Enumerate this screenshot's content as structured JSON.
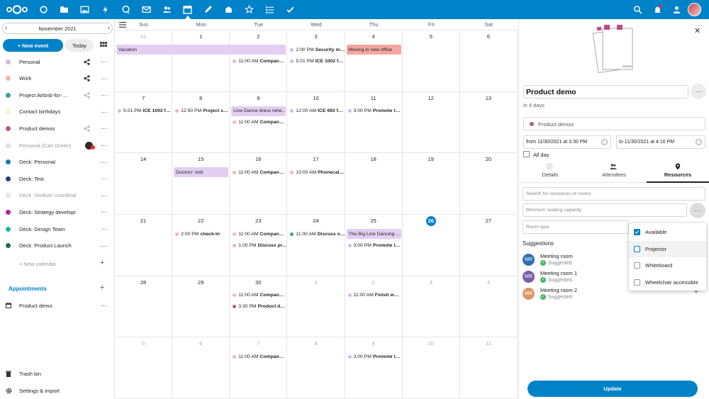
{
  "topbar": {
    "apps": [
      "dashboard-icon",
      "files-icon",
      "photos-icon",
      "activity-icon",
      "talk-icon",
      "mail-icon",
      "contacts-icon",
      "calendar-icon",
      "notes-icon",
      "deck-icon",
      "rating-icon",
      "tasks-icon",
      "check-icon"
    ],
    "right": [
      "search-icon",
      "notifications-icon",
      "contacts-menu-icon",
      "avatar"
    ]
  },
  "sidebar": {
    "month": "November 2021",
    "new_event": "+ New event",
    "today": "Today",
    "calendars": [
      {
        "label": "Personal",
        "color": "#d8b7e8",
        "share": true,
        "muted": false
      },
      {
        "label": "Work",
        "color": "#f3b6b1",
        "share": true,
        "muted": false
      },
      {
        "label": "Project Airbnb-for-…",
        "color": "#3e9e9e",
        "share": true,
        "muted": false
      },
      {
        "label": "Contact birthdays",
        "color": "#fbf3c8",
        "share": false,
        "muted": false
      },
      {
        "label": "Product demos",
        "color": "#b05a8e",
        "share": true,
        "muted": false
      },
      {
        "label": "Personal (Carl Green)",
        "color": "#f0dbe8",
        "share": false,
        "muted": true
      },
      {
        "label": "Deck: Personal",
        "color": "#0f7fa8",
        "share": false,
        "muted": false
      },
      {
        "label": "Deck: Test",
        "color": "#2a3a6e",
        "share": false,
        "muted": false
      },
      {
        "label": "Deck: Verilium coordination",
        "color": "#e4ecec",
        "share": false,
        "muted": true
      },
      {
        "label": "Deck: Strategy development",
        "color": "#b41fa3",
        "share": false,
        "muted": false
      },
      {
        "label": "Deck: Design Team",
        "color": "#1cb5a9",
        "share": false,
        "muted": false
      },
      {
        "label": "Deck: Product Launch",
        "color": "#1e6b55",
        "share": false,
        "muted": false
      }
    ],
    "new_calendar": "+ New calendar",
    "appointments_title": "Appointments",
    "appointment_item": "Product demo",
    "trash": "Trash bin",
    "settings": "Settings & import"
  },
  "calendar": {
    "days": [
      "Sun",
      "Mon",
      "Tue",
      "Wed",
      "Thu",
      "Fri",
      "Sat"
    ],
    "weeks": [
      [
        "31",
        "1",
        "2",
        "3",
        "4",
        "5",
        "6"
      ],
      [
        "7",
        "8",
        "9",
        "10",
        "11",
        "12",
        "13"
      ],
      [
        "14",
        "15",
        "16",
        "17",
        "18",
        "19",
        "20"
      ],
      [
        "21",
        "22",
        "23",
        "24",
        "25",
        "26",
        "27"
      ],
      [
        "28",
        "29",
        "30",
        "1",
        "2",
        "3",
        "4"
      ],
      [
        "5",
        "6",
        "7",
        "8",
        "9",
        "10",
        "11"
      ]
    ],
    "bars": [
      {
        "text": "Vacation",
        "week": 0,
        "startCol": 0,
        "span": 3,
        "color": "#e3cff2"
      },
      {
        "text": "Moving in new office",
        "week": 0,
        "startCol": 4,
        "span": 1,
        "color": "#f4a7a1"
      },
      {
        "text": "Line Dance dress rehe…",
        "week": 1,
        "startCol": 2,
        "span": 1,
        "color": "#e3cff2"
      },
      {
        "text": "Doctors' visit",
        "week": 2,
        "startCol": 1,
        "span": 1,
        "color": "#e3cff2"
      },
      {
        "text": "The Big Line Dancing …",
        "week": 3,
        "startCol": 4,
        "span": 1,
        "color": "#e3cff2"
      }
    ],
    "events": [
      {
        "week": 0,
        "col": 2,
        "row": 1,
        "time": "11:00 AM",
        "title": "Compan…",
        "color": "#f3b6b1"
      },
      {
        "week": 0,
        "col": 3,
        "row": 0,
        "time": "2:00 PM",
        "title": "Security m…",
        "color": "#d8b7e8"
      },
      {
        "week": 0,
        "col": 3,
        "row": 1,
        "time": "5:01 PM",
        "title": "ICE 1002 f…",
        "color": "#d8b7e8"
      },
      {
        "week": 1,
        "col": 0,
        "row": 0,
        "time": "5:01 PM",
        "title": "ICE 1002 f…",
        "color": "#d8b7e8"
      },
      {
        "week": 1,
        "col": 1,
        "row": 0,
        "time": "12:50 PM",
        "title": "Project s…",
        "color": "#f3b6b1"
      },
      {
        "week": 1,
        "col": 2,
        "row": 1,
        "time": "11:00 AM",
        "title": "Compan…",
        "color": "#f3b6b1"
      },
      {
        "week": 1,
        "col": 3,
        "row": 0,
        "time": "12:00 AM",
        "title": "ICE 693 f…",
        "color": "#d8b7e8"
      },
      {
        "week": 1,
        "col": 4,
        "row": 0,
        "time": "3:00 PM",
        "title": "Promote t…",
        "color": "#d8b7e8"
      },
      {
        "week": 2,
        "col": 2,
        "row": 0,
        "time": "11:00 AM",
        "title": "Compan…",
        "color": "#f3b6b1"
      },
      {
        "week": 2,
        "col": 3,
        "row": 0,
        "time": "10:00 AM",
        "title": "Phonecal…",
        "color": "#f3b6b1"
      },
      {
        "week": 3,
        "col": 1,
        "row": 0,
        "time": "2:00 PM",
        "title": "check-in",
        "color": "#f3b6b1"
      },
      {
        "week": 3,
        "col": 2,
        "row": 0,
        "time": "11:00 AM",
        "title": "Compan…",
        "color": "#f3b6b1"
      },
      {
        "week": 3,
        "col": 2,
        "row": 1,
        "time": "1:00 PM",
        "title": "Discuss pr…",
        "color": "#f3b6b1"
      },
      {
        "week": 3,
        "col": 3,
        "row": 0,
        "time": "11:00 AM",
        "title": "Discuss o…",
        "color": "#3e9e9e"
      },
      {
        "week": 3,
        "col": 4,
        "row": 1,
        "time": "3:00 PM",
        "title": "Promote t…",
        "color": "#d8b7e8"
      },
      {
        "week": 4,
        "col": 2,
        "row": 0,
        "time": "11:00 AM",
        "title": "Compan…",
        "color": "#f3b6b1"
      },
      {
        "week": 4,
        "col": 2,
        "row": 1,
        "time": "3:30 PM",
        "title": "Product d…",
        "color": "#b05a8e"
      },
      {
        "week": 4,
        "col": 4,
        "row": 0,
        "time": "11:00 AM",
        "title": "Finish w…",
        "color": "#d8b7e8"
      },
      {
        "week": 5,
        "col": 2,
        "row": 0,
        "time": "11:00 AM",
        "title": "Compan…",
        "color": "#f3b6b1"
      },
      {
        "week": 5,
        "col": 4,
        "row": 0,
        "time": "3:00 PM",
        "title": "Promote t…",
        "color": "#d8b7e8"
      }
    ]
  },
  "panel": {
    "title": "Product demo",
    "subtitle": "in 4 days",
    "calendar": "Product demos",
    "calendar_color": "#b05a8e",
    "from": "from 11/30/2021 at 3:30 PM",
    "to": "to 11/30/2021 at 4:10 PM",
    "all_day": "All day",
    "tabs": [
      "Details",
      "Attendees",
      "Resources"
    ],
    "search_placeholder": "Search for resources or rooms",
    "seating_placeholder": "Minimum seating capacity",
    "room_type_placeholder": "Room type",
    "suggestions_title": "Suggestions",
    "suggestions": [
      {
        "initials": "MR",
        "name": "Meeting room",
        "status": "Suggested.",
        "color": "#2f6fb5"
      },
      {
        "initials": "MR",
        "name": "Meeting room 1",
        "status": "Suggested.",
        "color": "#7b5ea7"
      },
      {
        "initials": "MR",
        "name": "Meeting room 2",
        "status": "Suggested.",
        "color": "#d9976a"
      }
    ],
    "dropdown": [
      {
        "label": "Available",
        "checked": true
      },
      {
        "label": "Projector",
        "checked": false
      },
      {
        "label": "Whiteboard",
        "checked": false
      },
      {
        "label": "Wheelchair accessible",
        "checked": false
      }
    ],
    "update": "Update"
  }
}
